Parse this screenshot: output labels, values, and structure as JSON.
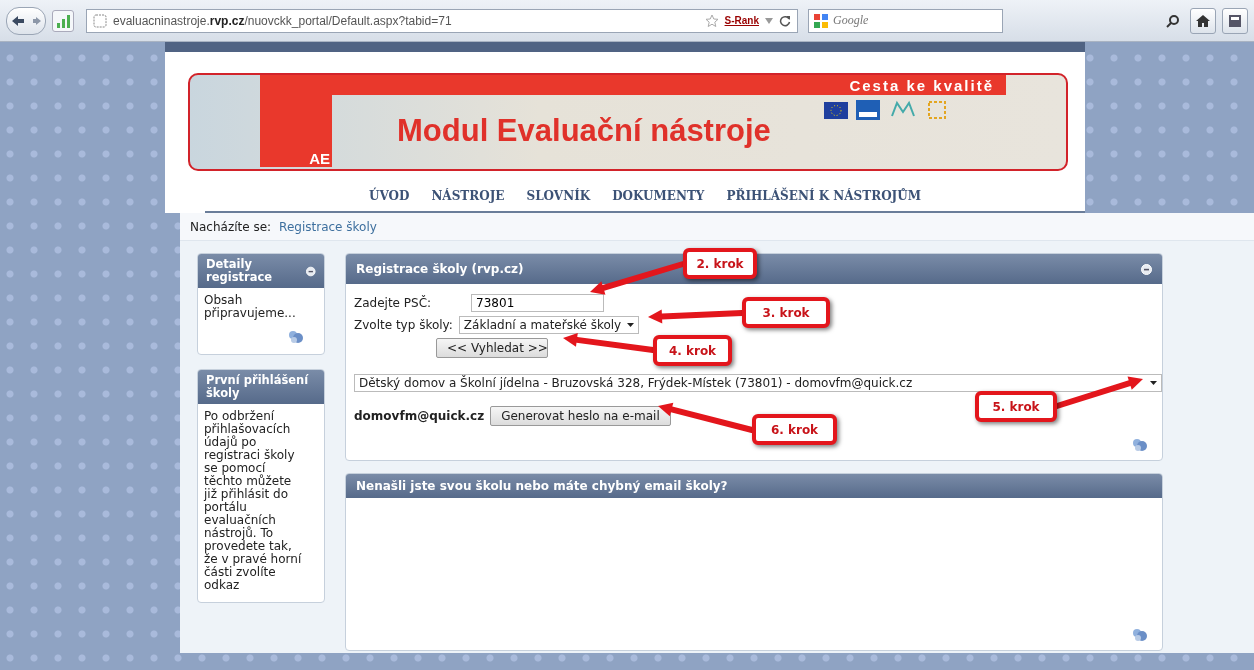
{
  "browser": {
    "url": "evaluacninastroje.**rvp.cz**/nuovckk_portal/Default.aspx?tabid=71",
    "rank": "S-Rank",
    "search_placeholder": "Google"
  },
  "banner": {
    "slogan": "Cesta ke kvalitě",
    "logo_text": "AE",
    "title": "Modul Evaluační nástroje"
  },
  "nav": [
    {
      "label": "ÚVOD"
    },
    {
      "label": "NÁSTROJE"
    },
    {
      "label": "SLOVNÍK"
    },
    {
      "label": "DOKUMENTY"
    },
    {
      "label": "PŘIHLÁŠENÍ K NÁSTROJŮM"
    }
  ],
  "breadcrumb": {
    "label": "Nacházíte se:",
    "link": "Registrace školy"
  },
  "sidebar": [
    {
      "title": "Detaily registrace",
      "body": "Obsah připravujeme...",
      "collapsible": true,
      "print": true
    },
    {
      "title": "První přihlášení školy",
      "body": "Po odbržení přihlašovacích údajů po registraci školy se pomocí těchto můžete již přihlásit do portálu evaluačních nástrojů. To provedete tak, že v pravé horní části zvolíte odkaz",
      "collapsible": false,
      "print": false
    }
  ],
  "registration": {
    "title": "Registrace školy (rvp.cz)",
    "zip_label": "Zadejte PSČ:",
    "zip_value": "73801",
    "type_label": "Zvolte typ školy:",
    "type_value": "Základní a mateřské školy",
    "search_button": "<< Vyhledat >>",
    "school_value": "Dětský domov a Školní jídelna - Bruzovská 328, Frýdek-Místek (73801) - domovfm@quick.cz",
    "email": "domovfm@quick.cz",
    "generate_button": "Generovat heslo na e-mail"
  },
  "missing_panel": {
    "title": "Nenašli jste svou školu nebo máte chybný email školy?"
  },
  "annotations": [
    {
      "label": "2. krok"
    },
    {
      "label": "3. krok"
    },
    {
      "label": "4. krok"
    },
    {
      "label": "5. krok"
    },
    {
      "label": "6. krok"
    }
  ]
}
